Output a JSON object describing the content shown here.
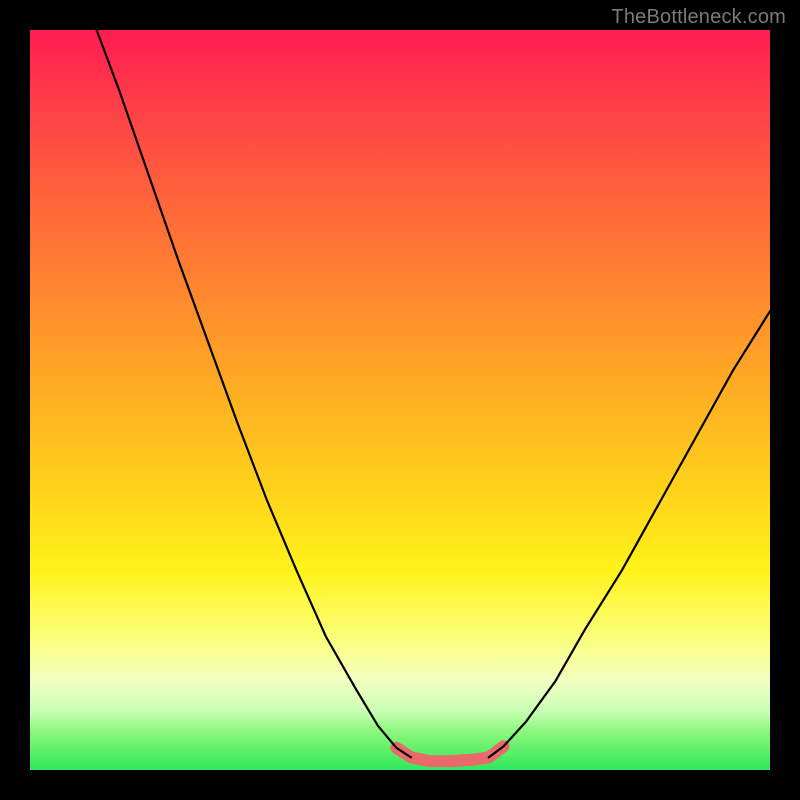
{
  "watermark": "TheBottleneck.com",
  "chart_data": {
    "type": "line",
    "title": "",
    "xlabel": "",
    "ylabel": "",
    "xlim": [
      0,
      100
    ],
    "ylim": [
      0,
      100
    ],
    "series": [
      {
        "name": "left-curve",
        "x": [
          9,
          12,
          16,
          20,
          24,
          28,
          32,
          36,
          40,
          44,
          47,
          49.5,
          51.5
        ],
        "y": [
          100,
          92,
          80.5,
          69,
          58,
          47,
          36.5,
          27,
          18,
          11,
          6,
          3,
          1.7
        ]
      },
      {
        "name": "right-curve",
        "x": [
          62,
          64,
          67,
          71,
          75,
          80,
          85,
          90,
          95,
          100
        ],
        "y": [
          1.7,
          3.2,
          6.5,
          12,
          19,
          27,
          36,
          45,
          54,
          62
        ]
      },
      {
        "name": "bottom-highlight",
        "x": [
          49.5,
          51.5,
          54,
          57,
          60,
          62,
          64
        ],
        "y": [
          3,
          1.7,
          1.2,
          1.2,
          1.4,
          1.7,
          3.2
        ]
      }
    ],
    "background_gradient": {
      "stops": [
        {
          "pos": 0.0,
          "color": "#ff1c52"
        },
        {
          "pos": 0.1,
          "color": "#ff3e47"
        },
        {
          "pos": 0.25,
          "color": "#ff6a38"
        },
        {
          "pos": 0.45,
          "color": "#ffa326"
        },
        {
          "pos": 0.62,
          "color": "#ffd21a"
        },
        {
          "pos": 0.73,
          "color": "#fff21a"
        },
        {
          "pos": 0.82,
          "color": "#fcff7a"
        },
        {
          "pos": 0.88,
          "color": "#f2ffc1"
        },
        {
          "pos": 0.92,
          "color": "#c9ffb4"
        },
        {
          "pos": 0.95,
          "color": "#88f77a"
        },
        {
          "pos": 1.0,
          "color": "#2ee85a"
        }
      ]
    },
    "highlight_color": "#ea6a6a",
    "curve_color": "#000000"
  }
}
